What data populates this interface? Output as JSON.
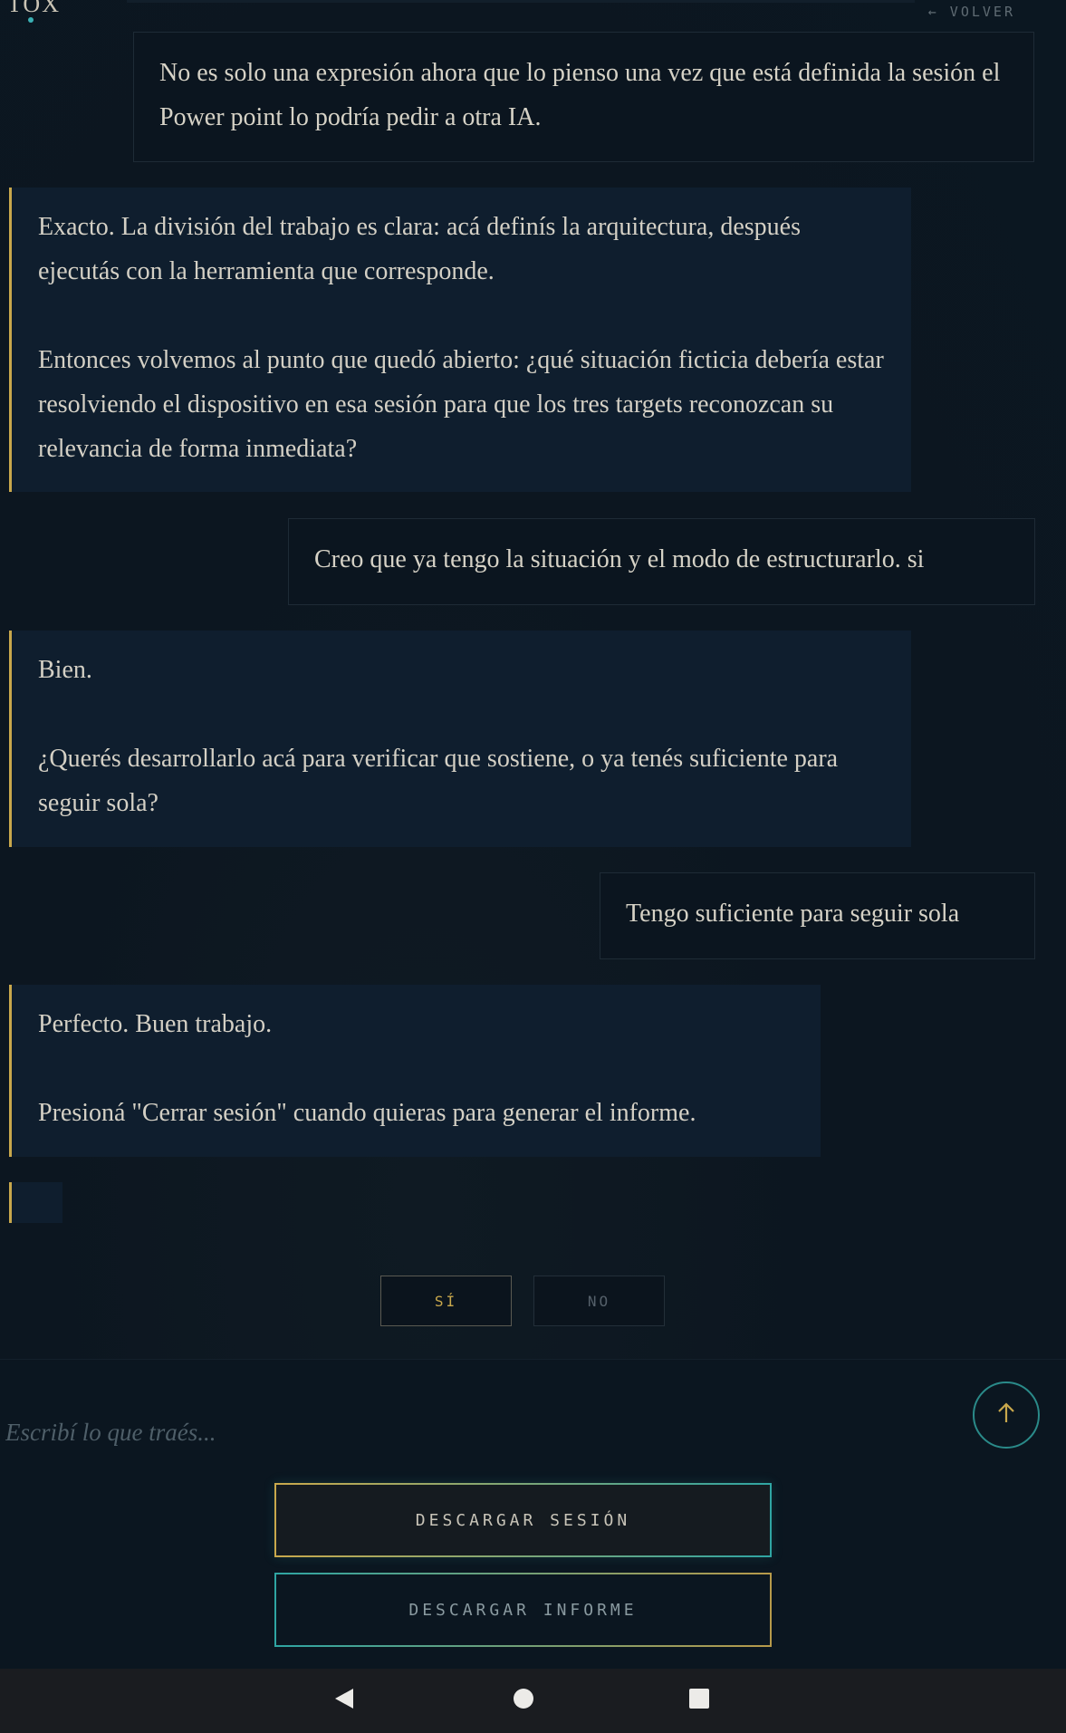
{
  "header": {
    "logo": "TOX",
    "back_label": "← VOLVER"
  },
  "messages": [
    {
      "role": "user",
      "paragraphs": [
        "No es solo una expresión ahora que lo pienso una vez que está definida la sesión el Power point lo podría pedir a otra IA."
      ]
    },
    {
      "role": "assistant",
      "paragraphs": [
        "Exacto. La división del trabajo es clara: acá definís la arquitectura, después ejecutás con la herramienta que corresponde.",
        "Entonces volvemos al punto que quedó abierto: ¿qué situación ficticia debería estar resolviendo el dispositivo en esa sesión para que los tres targets reconozcan su relevancia de forma inmediata?"
      ]
    },
    {
      "role": "user",
      "paragraphs": [
        "Creo que ya tengo la situación y el modo de estructurarlo. si"
      ]
    },
    {
      "role": "assistant",
      "paragraphs": [
        "Bien.",
        "¿Querés desarrollarlo acá para verificar que sostiene, o ya tenés suficiente para seguir sola?"
      ]
    },
    {
      "role": "user",
      "paragraphs": [
        "Tengo suficiente para seguir sola"
      ]
    },
    {
      "role": "assistant",
      "paragraphs": [
        "Perfecto. Buen trabajo.",
        "Presioná \"Cerrar sesión\" cuando quieras para generar el informe."
      ]
    }
  ],
  "choices": {
    "yes_label": "SÍ",
    "no_label": "NO"
  },
  "composer": {
    "placeholder": "Escribí lo que traés...",
    "value": "",
    "send_icon": "arrow-up-icon"
  },
  "actions": {
    "download_session": "DESCARGAR SESIÓN",
    "download_report": "DESCARGAR INFORME"
  },
  "navbar": {
    "icons": [
      "back-triangle-icon",
      "home-circle-icon",
      "recents-square-icon"
    ]
  },
  "colors": {
    "accent_gold": "#c9a84c",
    "accent_teal": "#2fa5a3",
    "background": "#0c1620",
    "assistant_bubble": "#0f1e2e"
  }
}
